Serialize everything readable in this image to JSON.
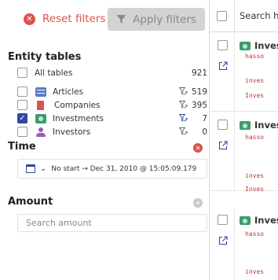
{
  "toolbar": {
    "reset_label": "Reset filters",
    "apply_label": "Apply filters",
    "reset_icon": "x-circle-icon",
    "apply_icon": "funnel-icon"
  },
  "entity_tables": {
    "title": "Entity tables",
    "all": {
      "label": "All tables",
      "count": "921",
      "checked": false
    },
    "items": [
      {
        "label": "Articles",
        "count": "519",
        "checked": false,
        "icon": "articles-icon",
        "color": "#5b7dc6"
      },
      {
        "label": "Companies",
        "count": "395",
        "checked": false,
        "icon": "companies-icon",
        "color": "#d9534f"
      },
      {
        "label": "Investments",
        "count": "7",
        "checked": true,
        "icon": "investments-icon",
        "color": "#3c9c6c"
      },
      {
        "label": "Investors",
        "count": "0",
        "checked": false,
        "icon": "investors-icon",
        "color": "#9b59b6"
      }
    ]
  },
  "time": {
    "title": "Time",
    "range": "No start → Dec 31, 2010 @ 15:05:09.179"
  },
  "amount": {
    "title": "Amount",
    "placeholder": "Search amount"
  },
  "results": {
    "header_title": "Search hi",
    "rows": [
      {
        "tag": "Inves",
        "code1": "hasso",
        "code2": "inves",
        "code3": "Inves"
      },
      {
        "tag": "Inves",
        "code1": "hasso",
        "code2": "inves",
        "code3": "Inves"
      },
      {
        "tag": "Inves",
        "code1": "hasso",
        "code2": "inves"
      }
    ]
  },
  "colors": {
    "danger": "#d9534f",
    "primary": "#2e4a9e",
    "disabled_button": "#d3d3d3",
    "code": "#c0392b"
  }
}
